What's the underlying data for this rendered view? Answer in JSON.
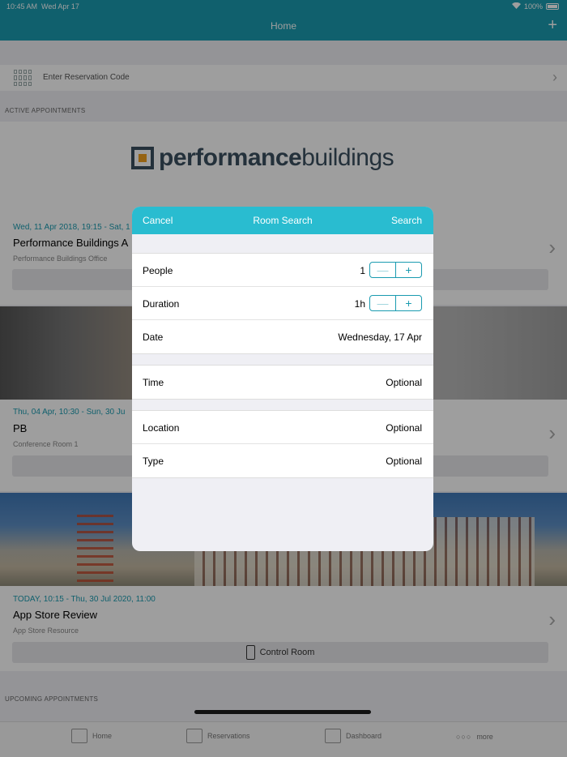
{
  "status": {
    "time": "10:45 AM",
    "date": "Wed Apr 17",
    "battery": "100%"
  },
  "nav": {
    "title": "Home",
    "add_label": "+"
  },
  "reservation": {
    "placeholder": "Enter Reservation Code"
  },
  "sections": {
    "active": "ACTIVE APPOINTMENTS",
    "upcoming": "UPCOMING APPOINTMENTS"
  },
  "logo": {
    "bold": "performance",
    "light": "buildings"
  },
  "appointments": [
    {
      "date": "Wed, 11 Apr 2018, 19:15 - Sat, 1",
      "title": "Performance Buildings A",
      "location": "Performance Buildings Office"
    },
    {
      "date": "Thu, 04 Apr, 10:30 - Sun, 30 Ju",
      "title": "PB",
      "location": "Conference Room 1"
    },
    {
      "date": "TODAY, 10:15 - Thu, 30 Jul 2020, 11:00",
      "title": "App Store Review",
      "location": "App Store Resource",
      "button": "Control Room"
    }
  ],
  "tabs": [
    {
      "label": "Home",
      "icon": "home-icon"
    },
    {
      "label": "Reservations",
      "icon": "calendar-icon"
    },
    {
      "label": "Dashboard",
      "icon": "building-icon"
    },
    {
      "label": "more",
      "icon": "more-icon"
    }
  ],
  "modal": {
    "cancel": "Cancel",
    "title": "Room Search",
    "search": "Search",
    "people": {
      "label": "People",
      "value": "1"
    },
    "duration": {
      "label": "Duration",
      "value": "1h"
    },
    "date": {
      "label": "Date",
      "value": "Wednesday, 17 Apr"
    },
    "time": {
      "label": "Time",
      "value": "Optional"
    },
    "location": {
      "label": "Location",
      "value": "Optional"
    },
    "type": {
      "label": "Type",
      "value": "Optional"
    },
    "minus": "—",
    "plus": "+"
  },
  "colors": {
    "accent": "#1a9bb0",
    "modal_header": "#29bcd0"
  }
}
